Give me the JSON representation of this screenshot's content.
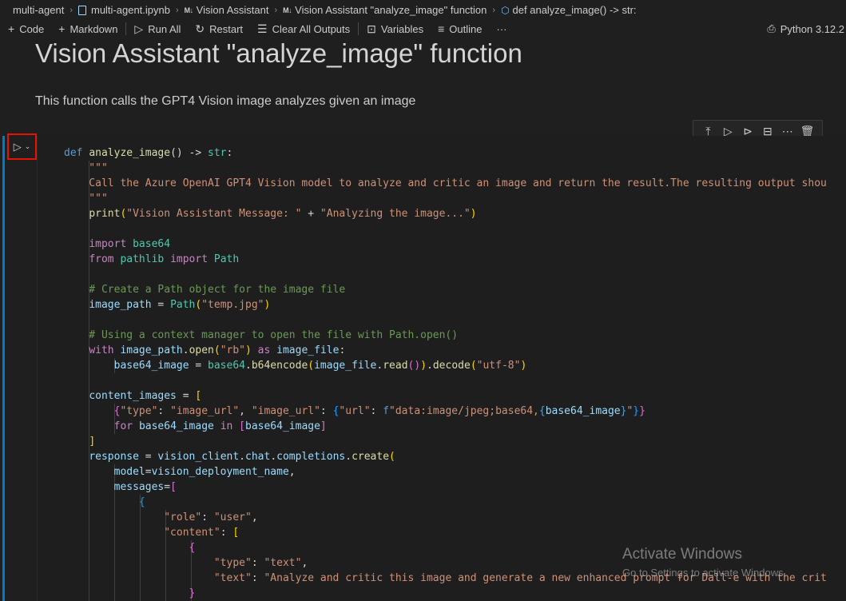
{
  "breadcrumb": [
    {
      "label": "multi-agent",
      "icon": ""
    },
    {
      "label": "multi-agent.ipynb",
      "icon": "notebook-icon"
    },
    {
      "label": "Vision Assistant",
      "icon": "markdown-icon"
    },
    {
      "label": "Vision Assistant \"analyze_image\" function",
      "icon": "markdown-icon"
    },
    {
      "label": "def analyze_image() -> str:",
      "icon": "function-icon"
    }
  ],
  "toolbar": {
    "code": "Code",
    "markdown": "Markdown",
    "run_all": "Run All",
    "restart": "Restart",
    "clear_outputs": "Clear All Outputs",
    "variables": "Variables",
    "outline": "Outline",
    "more": "···",
    "kernel": "Python 3.12.2"
  },
  "markdown_cell": {
    "title": "Vision Assistant \"analyze_image\" function",
    "paragraph": "This function calls the GPT4 Vision image analyzes given an image"
  },
  "code_cell": {
    "language": "python",
    "lines": [
      [
        [
          "kw",
          "def "
        ],
        [
          "fn",
          "analyze_image"
        ],
        [
          "op",
          "() -> "
        ],
        [
          "cls",
          "str"
        ],
        [
          "op",
          ":"
        ]
      ],
      [
        [
          "str",
          "    \"\"\""
        ]
      ],
      [
        [
          "str",
          "    Call the Azure OpenAI GPT4 Vision model to analyze and critic an image and return the result.The resulting output shou"
        ]
      ],
      [
        [
          "str",
          "    \"\"\""
        ]
      ],
      [
        [
          "op",
          "    "
        ],
        [
          "fn",
          "print"
        ],
        [
          "br1",
          "("
        ],
        [
          "str",
          "\"Vision Assistant Message: \""
        ],
        [
          "op",
          " + "
        ],
        [
          "str",
          "\"Analyzing the image...\""
        ],
        [
          "br1",
          ")"
        ]
      ],
      [],
      [
        [
          "op",
          "    "
        ],
        [
          "ctl",
          "import"
        ],
        [
          "op",
          " "
        ],
        [
          "cls",
          "base64"
        ]
      ],
      [
        [
          "op",
          "    "
        ],
        [
          "ctl",
          "from"
        ],
        [
          "op",
          " "
        ],
        [
          "cls",
          "pathlib"
        ],
        [
          "op",
          " "
        ],
        [
          "ctl",
          "import"
        ],
        [
          "op",
          " "
        ],
        [
          "cls",
          "Path"
        ]
      ],
      [],
      [
        [
          "cm",
          "    # Create a Path object for the image file"
        ]
      ],
      [
        [
          "op",
          "    "
        ],
        [
          "var",
          "image_path"
        ],
        [
          "op",
          " = "
        ],
        [
          "cls",
          "Path"
        ],
        [
          "br1",
          "("
        ],
        [
          "str",
          "\"temp.jpg\""
        ],
        [
          "br1",
          ")"
        ]
      ],
      [],
      [
        [
          "cm",
          "    # Using a context manager to open the file with Path.open()"
        ]
      ],
      [
        [
          "op",
          "    "
        ],
        [
          "ctl",
          "with"
        ],
        [
          "op",
          " "
        ],
        [
          "var",
          "image_path"
        ],
        [
          "op",
          "."
        ],
        [
          "fn",
          "open"
        ],
        [
          "br1",
          "("
        ],
        [
          "str",
          "\"rb\""
        ],
        [
          "br1",
          ")"
        ],
        [
          "op",
          " "
        ],
        [
          "ctl",
          "as"
        ],
        [
          "op",
          " "
        ],
        [
          "var",
          "image_file"
        ],
        [
          "op",
          ":"
        ]
      ],
      [
        [
          "op",
          "        "
        ],
        [
          "var",
          "base64_image"
        ],
        [
          "op",
          " = "
        ],
        [
          "cls",
          "base64"
        ],
        [
          "op",
          "."
        ],
        [
          "fn",
          "b64encode"
        ],
        [
          "br1",
          "("
        ],
        [
          "var",
          "image_file"
        ],
        [
          "op",
          "."
        ],
        [
          "fn",
          "read"
        ],
        [
          "br2",
          "()"
        ],
        [
          "br1",
          ")"
        ],
        [
          "op",
          "."
        ],
        [
          "fn",
          "decode"
        ],
        [
          "br1",
          "("
        ],
        [
          "str",
          "\"utf-8\""
        ],
        [
          "br1",
          ")"
        ]
      ],
      [],
      [
        [
          "op",
          "    "
        ],
        [
          "var",
          "content_images"
        ],
        [
          "op",
          " = "
        ],
        [
          "br1",
          "["
        ]
      ],
      [
        [
          "op",
          "        "
        ],
        [
          "br2",
          "{"
        ],
        [
          "str",
          "\"type\""
        ],
        [
          "op",
          ": "
        ],
        [
          "str",
          "\"image_url\""
        ],
        [
          "op",
          ", "
        ],
        [
          "str",
          "\"image_url\""
        ],
        [
          "op",
          ": "
        ],
        [
          "br3",
          "{"
        ],
        [
          "str",
          "\"url\""
        ],
        [
          "op",
          ": "
        ],
        [
          "kw",
          "f"
        ],
        [
          "str",
          "\"data:image/jpeg;base64,"
        ],
        [
          "kw",
          "{"
        ],
        [
          "var",
          "base64_image"
        ],
        [
          "kw",
          "}"
        ],
        [
          "str",
          "\""
        ],
        [
          "br3",
          "}"
        ],
        [
          "br2",
          "}"
        ]
      ],
      [
        [
          "op",
          "        "
        ],
        [
          "ctl",
          "for"
        ],
        [
          "op",
          " "
        ],
        [
          "var",
          "base64_image"
        ],
        [
          "op",
          " "
        ],
        [
          "ctl",
          "in"
        ],
        [
          "op",
          " "
        ],
        [
          "br2",
          "["
        ],
        [
          "var",
          "base64_image"
        ],
        [
          "br2",
          "]"
        ]
      ],
      [
        [
          "op",
          "    "
        ],
        [
          "br1",
          "]"
        ]
      ],
      [
        [
          "op",
          "    "
        ],
        [
          "var",
          "response"
        ],
        [
          "op",
          " = "
        ],
        [
          "var",
          "vision_client"
        ],
        [
          "op",
          "."
        ],
        [
          "var",
          "chat"
        ],
        [
          "op",
          "."
        ],
        [
          "var",
          "completions"
        ],
        [
          "op",
          "."
        ],
        [
          "fn",
          "create"
        ],
        [
          "br1",
          "("
        ]
      ],
      [
        [
          "op",
          "        "
        ],
        [
          "var",
          "model"
        ],
        [
          "op",
          "="
        ],
        [
          "var",
          "vision_deployment_name"
        ],
        [
          "op",
          ","
        ]
      ],
      [
        [
          "op",
          "        "
        ],
        [
          "var",
          "messages"
        ],
        [
          "op",
          "="
        ],
        [
          "br2",
          "["
        ]
      ],
      [
        [
          "op",
          "            "
        ],
        [
          "br3",
          "{"
        ]
      ],
      [
        [
          "op",
          "                "
        ],
        [
          "str",
          "\"role\""
        ],
        [
          "op",
          ": "
        ],
        [
          "str",
          "\"user\""
        ],
        [
          "op",
          ","
        ]
      ],
      [
        [
          "op",
          "                "
        ],
        [
          "str",
          "\"content\""
        ],
        [
          "op",
          ": "
        ],
        [
          "br1",
          "["
        ]
      ],
      [
        [
          "op",
          "                    "
        ],
        [
          "br2",
          "{"
        ]
      ],
      [
        [
          "op",
          "                        "
        ],
        [
          "str",
          "\"type\""
        ],
        [
          "op",
          ": "
        ],
        [
          "str",
          "\"text\""
        ],
        [
          "op",
          ","
        ]
      ],
      [
        [
          "op",
          "                        "
        ],
        [
          "str",
          "\"text\""
        ],
        [
          "op",
          ": "
        ],
        [
          "str",
          "\"Analyze and critic this image and generate a new enhanced prompt for Dall-e with the crit"
        ]
      ],
      [
        [
          "op",
          "                    "
        ],
        [
          "br2",
          "}"
        ]
      ]
    ]
  },
  "cell_toolbar": [
    "execute-above-icon",
    "execute-below-icon",
    "run-by-line-icon",
    "split-cell-icon",
    "more-icon",
    "delete-icon"
  ],
  "watermark": {
    "title": "Activate Windows",
    "subtitle": "Go to Settings to activate Windows."
  },
  "colors": {
    "editor_bg": "#1e1e1e",
    "accent": "#007acc",
    "highlight_border": "#e51400"
  }
}
